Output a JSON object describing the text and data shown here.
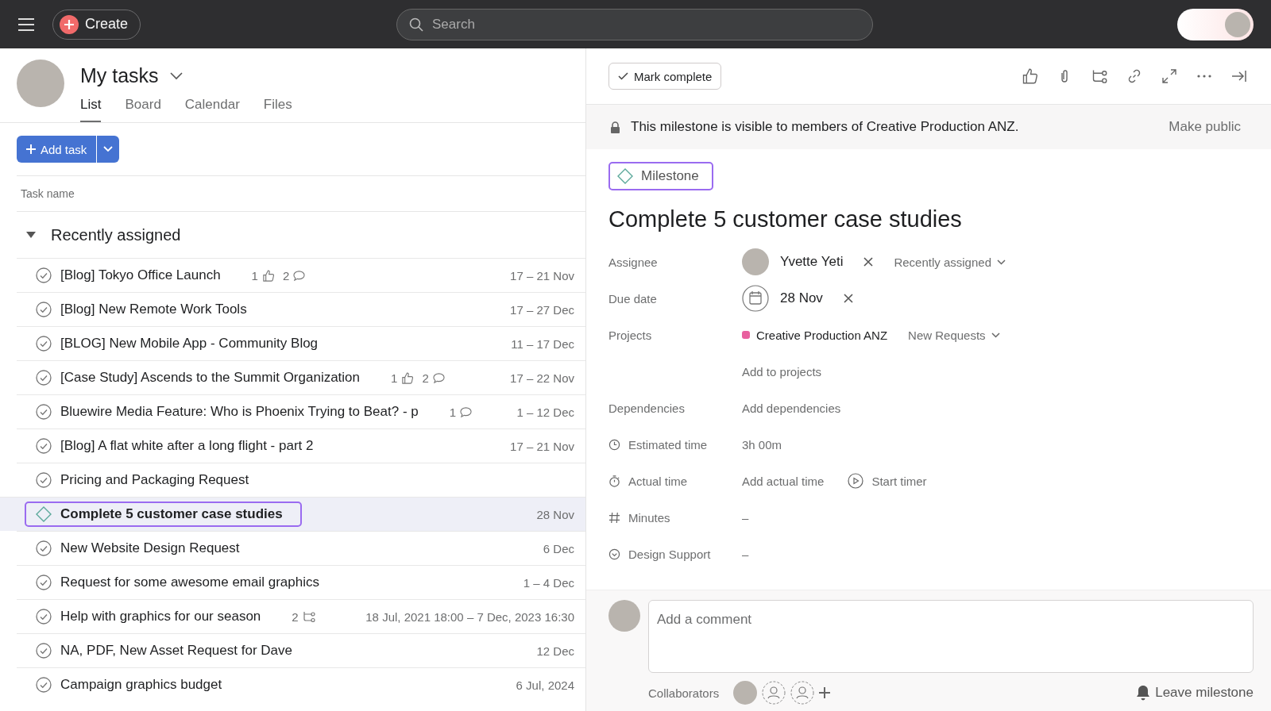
{
  "topbar": {
    "create_label": "Create",
    "search": {
      "placeholder": "Search"
    }
  },
  "header": {
    "title": "My tasks",
    "tabs": [
      {
        "label": "List",
        "selected": true
      },
      {
        "label": "Board",
        "selected": false
      },
      {
        "label": "Calendar",
        "selected": false
      },
      {
        "label": "Files",
        "selected": false
      }
    ]
  },
  "add_task_label": "Add task",
  "table": {
    "column": "Task name",
    "section": {
      "title": "Recently assigned",
      "expanded": true
    },
    "rows": [
      {
        "kind": "task",
        "name": "[Blog] Tokyo Office Launch",
        "likes": "1",
        "comments": "2",
        "date": "17 – 21 Nov",
        "selected": false
      },
      {
        "kind": "task",
        "name": "[Blog] New Remote Work Tools",
        "date": "17 – 27 Dec",
        "selected": false
      },
      {
        "kind": "task",
        "name": "[BLOG] New Mobile App - Community Blog",
        "date": "11 – 17 Dec",
        "selected": false
      },
      {
        "kind": "task",
        "name": "[Case Study] Ascends to the Summit Organization",
        "likes": "1",
        "comments": "2",
        "date": "17 – 22 Nov",
        "selected": false
      },
      {
        "kind": "task",
        "name": "Bluewire Media Feature: Who is Phoenix Trying to Beat? - p",
        "comments": "1",
        "date": "1 – 12 Dec",
        "selected": false
      },
      {
        "kind": "task",
        "name": "[Blog] A flat white after a long flight - part 2",
        "date": "17 – 21 Nov",
        "selected": false
      },
      {
        "kind": "task",
        "name": "Pricing and Packaging Request",
        "selected": false
      },
      {
        "kind": "milestone",
        "name": "Complete 5 customer case studies",
        "date": "28 Nov",
        "selected": true
      },
      {
        "kind": "task",
        "name": "New Website Design Request",
        "date": "6 Dec",
        "selected": false
      },
      {
        "kind": "task",
        "name": "Request for some awesome email graphics",
        "date": "1 – 4 Dec",
        "selected": false
      },
      {
        "kind": "task",
        "name": "Help with graphics for our season",
        "subtasks": "2",
        "date": "18 Jul, 2021 18:00 – 7 Dec, 2023 16:30",
        "selected": false
      },
      {
        "kind": "task",
        "name": "NA, PDF, New Asset Request for Dave",
        "date": "12 Dec",
        "selected": false
      },
      {
        "kind": "task",
        "name": "Campaign graphics budget",
        "date": "6 Jul, 2024",
        "selected": false
      }
    ]
  },
  "detail": {
    "mark_complete": "Mark complete",
    "notice": "This milestone is visible to members of Creative Production ANZ.",
    "make_public": "Make public",
    "type_label": "Milestone",
    "title": "Complete 5 customer case studies",
    "fields": [
      {
        "kind": "person",
        "label": "Assignee",
        "value": "Yvette Yeti",
        "extra": "Recently assigned"
      },
      {
        "kind": "date",
        "label": "Due date",
        "value": "28 Nov"
      },
      {
        "kind": "project",
        "label": "Projects",
        "value": "Creative Production ANZ",
        "color": "#e8609f",
        "extra": "New Requests"
      },
      {
        "kind": "action",
        "value": "Add to projects"
      },
      {
        "kind": "action",
        "label": "Dependencies",
        "value": "Add dependencies"
      },
      {
        "kind": "estimate",
        "label": "Estimated time",
        "value": "3h 00m"
      },
      {
        "kind": "timer",
        "label": "Actual time",
        "value": "Add actual time",
        "extra": "Start timer"
      },
      {
        "kind": "number",
        "label": "Minutes",
        "value": "–"
      },
      {
        "kind": "select",
        "label": "Design Support",
        "value": "–"
      }
    ],
    "comment": {
      "placeholder": "Add a comment"
    },
    "collaborators_label": "Collaborators",
    "leave_label": "Leave milestone"
  }
}
